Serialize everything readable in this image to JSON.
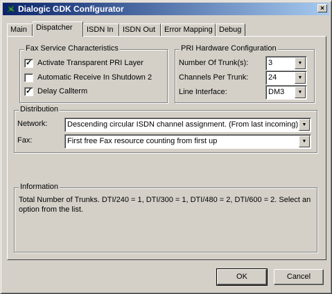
{
  "window": {
    "title": "Dialogic GDK Configurator",
    "close": "×"
  },
  "tabs": [
    {
      "label": "Main"
    },
    {
      "label": "Dispatcher"
    },
    {
      "label": "ISDN In"
    },
    {
      "label": "ISDN Out"
    },
    {
      "label": "Error Mapping"
    },
    {
      "label": "Debug"
    }
  ],
  "fax_service": {
    "title": "Fax Service Characteristics",
    "options": [
      {
        "label": "Activate Transparent PRI Layer",
        "checked": "✓"
      },
      {
        "label": "Automatic Receive In Shutdown 2",
        "checked": ""
      },
      {
        "label": "Delay Callterm",
        "checked": "✓"
      }
    ]
  },
  "pri_hw": {
    "title": "PRI Hardware Configuration",
    "trunks_label": "Number Of Trunk(s):",
    "trunks_value": "3",
    "channels_label": "Channels Per Trunk:",
    "channels_value": "24",
    "line_label": "Line Interface:",
    "line_value": "DM3"
  },
  "distribution": {
    "title": "Distribution",
    "network_label": "Network:",
    "network_value": "Descending circular ISDN channel assignment. (From last incoming)",
    "fax_label": "Fax:",
    "fax_value": "First free Fax resource counting from first up"
  },
  "information": {
    "title": "Information",
    "text": "Total Number of Trunks.  DTI/240 = 1, DTI/300 = 1, DTI/480 = 2, DTI/600 = 2.  Select an option from the list."
  },
  "buttons": {
    "ok": "OK",
    "cancel": "Cancel"
  }
}
